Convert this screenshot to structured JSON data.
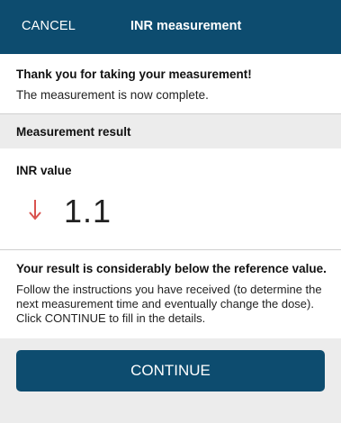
{
  "app_bar": {
    "cancel_label": "CANCEL",
    "title": "INR measurement",
    "background": "#0d4c6f"
  },
  "confirmation": {
    "title": "Thank you for taking your measurement!",
    "message": "The measurement is now complete."
  },
  "section": {
    "header": "Measurement result"
  },
  "inr": {
    "label": "INR value",
    "value": "1.1",
    "trend_icon": "arrow-down-icon",
    "trend_color": "#d9534f"
  },
  "result": {
    "title": "Your result is considerably below the reference value.",
    "instructions": "Follow the instructions you have received (to determine the next measurement time and eventually change the dose). Click CONTINUE to fill in the details."
  },
  "footer": {
    "continue_label": "CONTINUE",
    "button_color": "#0d4c6f"
  }
}
